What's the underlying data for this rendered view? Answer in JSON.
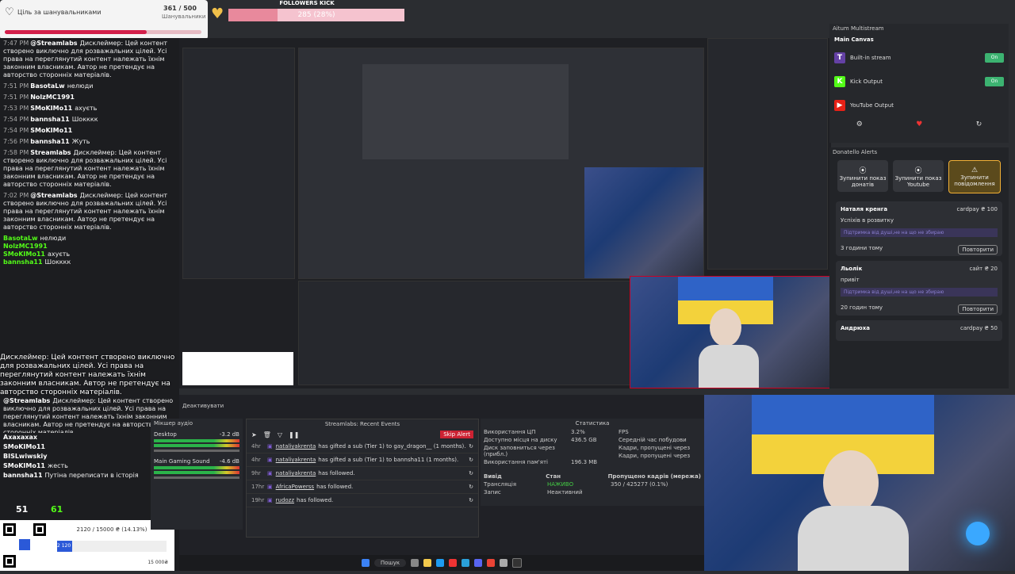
{
  "goal": {
    "title": "Ціль за шанувальниками",
    "count": "361 / 500",
    "sub": "Шанувальники",
    "progress": 0.72
  },
  "kick": {
    "title": "FOLLOWERS KICK",
    "label": "285 (28%)",
    "progress": 0.28
  },
  "chat": [
    {
      "time": "7:47 PM",
      "user": "@Streamlabs",
      "text": "Дисклеймер: Цей контент створено виключно для розважальних цілей. Усі права на переглянутий контент належать їхнім законним власникам. Автор не претендує на авторство сторонніх матеріалів."
    },
    {
      "time": "7:51 PM",
      "user": "BasotaLw",
      "text": "нелюди"
    },
    {
      "time": "7:51 PM",
      "user": "NolzMC1991",
      "text": ""
    },
    {
      "time": "7:53 PM",
      "user": "SMoKIMo11",
      "text": "ахуєть"
    },
    {
      "time": "7:54 PM",
      "user": "bannsha11",
      "text": "Шокккк"
    },
    {
      "time": "7:54 PM",
      "user": "SMoKIMo11",
      "text": ""
    },
    {
      "time": "7:56 PM",
      "user": "bannsha11",
      "text": "Жуть"
    },
    {
      "time": "7:58 PM",
      "user": "Streamlabs",
      "text": "Дисклеймер: Цей контент створено виключно для розважальних цілей. Усі права на переглянутий контент належать їхнім законним власникам. Автор не претендує на авторство сторонніх матеріалів."
    },
    {
      "time": "7:02 PM",
      "user": "@Streamlabs",
      "text": "Дисклеймер: Цей контент створено виключно для розважальних цілей. Усі права на переглянутий контент належать їхнім законним власникам. Автор не претендує на авторство сторонніх матеріалів."
    }
  ],
  "overlay_chat": [
    {
      "user": "BasotaLw",
      "text": "нелюди"
    },
    {
      "user": "NolzMC1991",
      "text": ""
    },
    {
      "user": "SMoKIMo11",
      "text": "ахуєть"
    },
    {
      "user": "bannsha11",
      "text": "Шокккк"
    }
  ],
  "overlay_disclaimer": "Дисклеймер: Цей контент створено виключно для розважальних цілей. Усі права на переглянутий контент належать їхнім законним власникам. Автор не претендує на авторство сторонніх матеріалів.",
  "bottom_chat": [
    {
      "user": "@Streamlabs",
      "text": "Дисклеймер: Цей контент створено виключно для розважальних цілей. Усі права на переглянутий контент належать їхнім законним власникам. Автор не претендує на авторство сторонніх матеріалів."
    },
    {
      "user": "Ахахахах",
      "text": ""
    },
    {
      "user": "SMoKIMo11",
      "text": ""
    },
    {
      "user": "BISLwiwskiy",
      "text": ""
    },
    {
      "user": "SMoKIMo11",
      "text": "жесть"
    },
    {
      "user": "bannsha11",
      "text": "Путіна переписати в історія"
    }
  ],
  "viewers": {
    "count1": "51",
    "count2": "61"
  },
  "donation_box": {
    "amount": "2120 / 15000 ₴ (14.13%)",
    "max": "15 000₴",
    "min": "2 120"
  },
  "multistream": {
    "title": "Aitum Multistream",
    "canvas": "Main Canvas",
    "outputs": [
      {
        "name": "Built-in stream",
        "color": "#6441a5",
        "icon": "T"
      },
      {
        "name": "Kick Output",
        "color": "#53fc18",
        "icon": "K"
      },
      {
        "name": "YouTube Output",
        "color": "#e62117",
        "icon": "▶"
      }
    ],
    "toggle": "On"
  },
  "donatello": {
    "title": "Donatello Alerts",
    "buttons": [
      "Зупинити показ донатів",
      "Зупинити показ Youtube",
      "Зупинити повідомлення"
    ],
    "cards": [
      {
        "name": "Наталя кренга",
        "amount": "cardpay ₴ 100",
        "text": "Успіхів в розвитку",
        "support": "Підтримка від душі,не на що не збираю",
        "when": "3 години тому",
        "repeat": "Повторити"
      },
      {
        "name": "Льолік",
        "amount": "сайт ₴ 20",
        "text": "привіт",
        "support": "Підтримка від душі,не на що не збираю",
        "when": "20 годин тому",
        "repeat": "Повторити"
      },
      {
        "name": "Андрюха",
        "amount": "cardpay ₴ 50",
        "text": "",
        "support": "",
        "when": "",
        "repeat": ""
      }
    ]
  },
  "events": {
    "title": "Streamlabs: Recent Events",
    "skip": "Skip Alert",
    "items": [
      {
        "age": "4hr",
        "user": "nataliyakrenta",
        "text": "has gifted a sub (Tier 1) to gay_dragon__ (1 months)."
      },
      {
        "age": "4hr",
        "user": "nataliyakrenta",
        "text": "has gifted a sub (Tier 1) to bannsha11 (1 months)."
      },
      {
        "age": "9hr",
        "user": "nataliyakrenta",
        "text": "has followed."
      },
      {
        "age": "17hr",
        "user": "AfricaPowerss",
        "text": "has followed."
      },
      {
        "age": "19hr",
        "user": "rudozz",
        "text": "has followed."
      }
    ]
  },
  "stats": {
    "title": "Статистика",
    "rows": [
      {
        "k": "Використання ЦП",
        "v": "3.2%"
      },
      {
        "k": "Доступно місця на диску",
        "v": "436.5 GB"
      },
      {
        "k": "Диск заповниться через (прибл.)",
        "v": ""
      },
      {
        "k": "Використання пам'яті",
        "v": "196.3 MB"
      }
    ],
    "right": [
      "FPS",
      "Середній час побудови",
      "Кадри, пропущені через",
      "Кадри, пропущені через"
    ],
    "table_header": [
      "Вивід",
      "Стан",
      "Пропущено кадрів (мережа)"
    ],
    "table": [
      {
        "out": "Трансляція",
        "state": "НАЖИВО",
        "dropped": "350 / 425277 (0.1%)"
      },
      {
        "out": "Запис",
        "state": "Неактивний",
        "dropped": ""
      }
    ]
  },
  "mixer": {
    "title": "Мікшер аудіо",
    "tracks": [
      {
        "name": "Desktop",
        "db": "-3.2 dB"
      },
      {
        "name": "Main Gaming Sound",
        "db": "-4.6 dB"
      }
    ]
  },
  "deactivate": "Деактивувати",
  "taskbar": {
    "search": "Пошук"
  }
}
